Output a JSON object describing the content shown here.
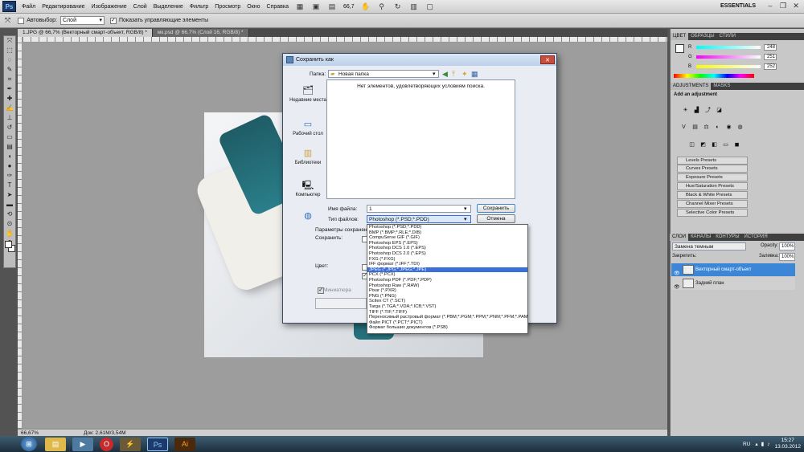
{
  "app": {
    "logo": "Ps",
    "workspace": "ESSENTIALS",
    "zoom_menu": "66,7"
  },
  "menu": [
    "Файл",
    "Редактирование",
    "Изображение",
    "Слой",
    "Выделение",
    "Фильтр",
    "Просмотр",
    "Окно",
    "Справка"
  ],
  "options": {
    "auto_select_label": "Автовыбор:",
    "auto_select_value": "Слой",
    "show_controls": "Показать управляющие элементы"
  },
  "tabs": [
    {
      "label": "1.JPG @ 66,7% (Векторный смарт-объект, RGB/8) *"
    },
    {
      "label": "мк.psd @ 66,7% (Слой 16, RGB/8) *"
    }
  ],
  "status": {
    "zoom": "66,67%",
    "doc": "Док: 2,61M/3,54M"
  },
  "color_panel": {
    "tabs": [
      "ЦВЕТ",
      "ОБРАЗЦЫ",
      "СТИЛИ"
    ],
    "r_label": "R",
    "g_label": "G",
    "b_label": "B",
    "r": "248",
    "g": "251",
    "b": "252"
  },
  "adjustments": {
    "tabs": [
      "ADJUSTMENTS",
      "MASKS"
    ],
    "title": "Add an adjustment",
    "presets": [
      "Levels Presets",
      "Curves Presets",
      "Exposure Presets",
      "Hue/Saturation Presets",
      "Black & White Presets",
      "Channel Mixer Presets",
      "Selective Color Presets"
    ]
  },
  "layers": {
    "tabs": [
      "СЛОИ",
      "КАНАЛЫ",
      "КОНТУРЫ",
      "ИСТОРИЯ"
    ],
    "blend": "Замена темным",
    "opacity_label": "Opacity:",
    "opacity": "100%",
    "lock_label": "Закрепить:",
    "fill_label": "Заливка:",
    "fill": "100%",
    "items": [
      {
        "name": "Векторный смарт-объект"
      },
      {
        "name": "Задний план"
      }
    ]
  },
  "dialog": {
    "title": "Сохранить как",
    "folder_label": "Папка:",
    "folder": "Новая папка",
    "empty_msg": "Нет элементов, удовлетворяющих условиям поиска.",
    "places": [
      "Недавние места",
      "Рабочий стол",
      "Библиотеки",
      "Компьютер",
      ""
    ],
    "filename_label": "Имя файла:",
    "filename": "1",
    "filetype_label": "Тип файлов:",
    "filetype": "Photoshop (*.PSD;*.PDD)",
    "save": "Сохранить",
    "cancel": "Отмена",
    "params_label": "Параметры сохранения",
    "save_sub_label": "Сохранить:",
    "color_label": "Цвет:",
    "thumbnail_label": "Миниатюра",
    "formats": [
      "Photoshop (*.PSD;*.PDD)",
      "BMP (*.BMP;*.RLE;*.DIB)",
      "CompuServe GIF (*.GIF)",
      "Photoshop EPS (*.EPS)",
      "Photoshop DCS 1.0 (*.EPS)",
      "Photoshop DCS 2.0 (*.EPS)",
      "FXG (*.FXG)",
      "IFF формат (*.IFF;*.TDI)",
      "JPEG (*.JPG;*.JPEG;*.JPE)",
      "PCX (*.PCX)",
      "Photoshop PDF (*.PDF;*.PDP)",
      "Photoshop Raw (*.RAW)",
      "Pixar (*.PXR)",
      "PNG (*.PNG)",
      "Scitex CT (*.SCT)",
      "Targa (*.TGA;*.VDA;*.ICB;*.VST)",
      "TIFF (*.TIF;*.TIFF)",
      "Переносимый растровый формат (*.PBM;*.PGM;*.PPM;*.PNM;*.PFM;*.PAM)",
      "Файл PICT (*.PCT;*.PICT)",
      "Формат больших документов (*.PSB)"
    ],
    "selected_format_index": 8
  },
  "taskbar": {
    "lang": "RU",
    "time": "15:27",
    "date": "13.03.2012"
  }
}
